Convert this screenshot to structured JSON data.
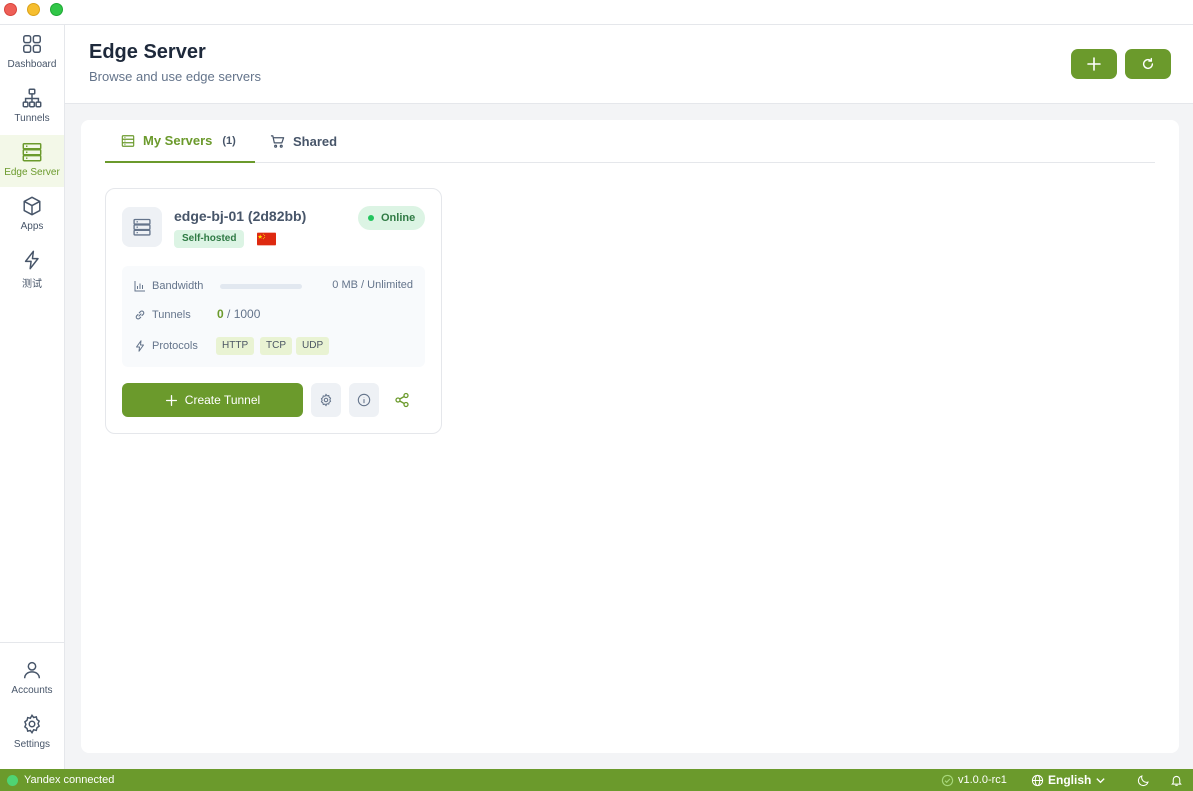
{
  "sidebar": {
    "items": [
      {
        "label": "Dashboard",
        "icon": "dashboard-icon"
      },
      {
        "label": "Tunnels",
        "icon": "network-icon"
      },
      {
        "label": "Edge Server",
        "icon": "server-icon",
        "active": true
      },
      {
        "label": "Apps",
        "icon": "cube-icon"
      },
      {
        "label": "测试",
        "icon": "lightning-icon"
      }
    ],
    "bottom_items": [
      {
        "label": "Accounts",
        "icon": "user-icon"
      },
      {
        "label": "Settings",
        "icon": "gear-icon"
      }
    ]
  },
  "header": {
    "title": "Edge Server",
    "subtitle": "Browse and use edge servers"
  },
  "tabs": {
    "my_servers": {
      "label": "My Servers",
      "count": "(1)"
    },
    "shared": {
      "label": "Shared"
    }
  },
  "server_card": {
    "name": "edge-bj-01 (2d82bb)",
    "type_badge": "Self-hosted",
    "status": "Online",
    "bandwidth": {
      "label": "Bandwidth",
      "value": "0 MB / Unlimited",
      "used_fraction": 0
    },
    "tunnels": {
      "label": "Tunnels",
      "used": "0",
      "limit": "/ 1000"
    },
    "protocols": {
      "label": "Protocols",
      "items": [
        "HTTP",
        "TCP",
        "UDP"
      ]
    },
    "create_label": "Create Tunnel"
  },
  "statusbar": {
    "connection": "Yandex connected",
    "version": "v1.0.0-rc1",
    "language": "English"
  },
  "colors": {
    "accent": "#6b9a2c",
    "online_bg": "#dcf4e4",
    "online_text": "#2f7a44"
  }
}
